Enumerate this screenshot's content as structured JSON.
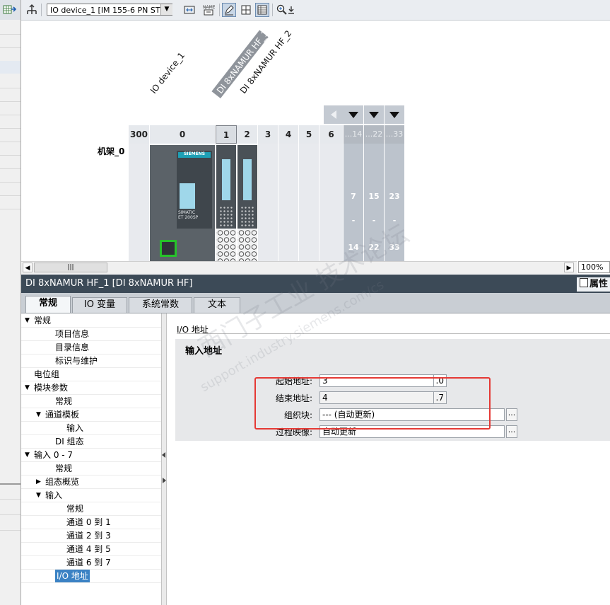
{
  "toolbar": {
    "device_select": "IO device_1 [IM 155-6 PN ST]"
  },
  "device_view": {
    "rotated_labels": [
      "IO device_1",
      "DI 8xNAMUR HF_1",
      "DI 8xNAMUR HF_2"
    ],
    "rack_label": "机架_0",
    "slots": [
      "300",
      "0",
      "1",
      "2",
      "3",
      "4",
      "5",
      "6"
    ],
    "ext_slots": [
      {
        "head": "...14",
        "top": "7",
        "mid": "-",
        "bottom": "14"
      },
      {
        "head": "...22",
        "top": "15",
        "mid": "-",
        "bottom": "22"
      },
      {
        "head": "...33",
        "top": "23",
        "mid": "-",
        "bottom": "33"
      }
    ],
    "head_module_brand": "SIEMENS",
    "head_module_text": "SIMATIC\nET 200SP",
    "zoom": "100%",
    "hscroll_grip": "|||"
  },
  "properties": {
    "title": "DI 8xNAMUR HF_1 [DI 8xNAMUR HF]",
    "right_tab": "属性",
    "tabs": [
      "常规",
      "IO 变量",
      "系统常数",
      "文本"
    ],
    "tree": [
      {
        "label": "常规",
        "level": 0,
        "exp": "down"
      },
      {
        "label": "项目信息",
        "level": 2,
        "exp": ""
      },
      {
        "label": "目录信息",
        "level": 2,
        "exp": ""
      },
      {
        "label": "标识与维护",
        "level": 2,
        "exp": ""
      },
      {
        "label": "电位组",
        "level": 0,
        "exp": ""
      },
      {
        "label": "模块参数",
        "level": 0,
        "exp": "down"
      },
      {
        "label": "常规",
        "level": 2,
        "exp": ""
      },
      {
        "label": "通道模板",
        "level": 1,
        "exp": "down"
      },
      {
        "label": "输入",
        "level": 3,
        "exp": ""
      },
      {
        "label": "DI 组态",
        "level": 2,
        "exp": ""
      },
      {
        "label": "输入 0 - 7",
        "level": 0,
        "exp": "down"
      },
      {
        "label": "常规",
        "level": 2,
        "exp": ""
      },
      {
        "label": "组态概览",
        "level": 1,
        "exp": "right"
      },
      {
        "label": "输入",
        "level": 1,
        "exp": "down"
      },
      {
        "label": "常规",
        "level": 3,
        "exp": ""
      },
      {
        "label": "通道 0 到 1",
        "level": 3,
        "exp": ""
      },
      {
        "label": "通道 2 到 3",
        "level": 3,
        "exp": ""
      },
      {
        "label": "通道 4 到 5",
        "level": 3,
        "exp": ""
      },
      {
        "label": "通道 6 到 7",
        "level": 3,
        "exp": ""
      },
      {
        "label": "I/O 地址",
        "level": 2,
        "exp": "",
        "selected": true
      }
    ],
    "section_title": "I/O 地址",
    "group_title": "输入地址",
    "fields": {
      "start_label": "起始地址:",
      "start_value": "3",
      "start_suffix": ".0",
      "end_label": "结束地址:",
      "end_value": "4",
      "end_suffix": ".7",
      "ob_label": "组织块:",
      "ob_value": "--- (自动更新)",
      "pi_label": "过程映像:",
      "pi_value": "自动更新",
      "dots": "..."
    }
  },
  "watermark": {
    "line1": "西门子工业 技术论坛",
    "line2": "support.industry.siemens.com/cs"
  },
  "colors": {
    "title_bar": "#3c4a57",
    "highlight": "#e53935",
    "port_green": "#26c22a",
    "selection": "#3b82c4"
  }
}
